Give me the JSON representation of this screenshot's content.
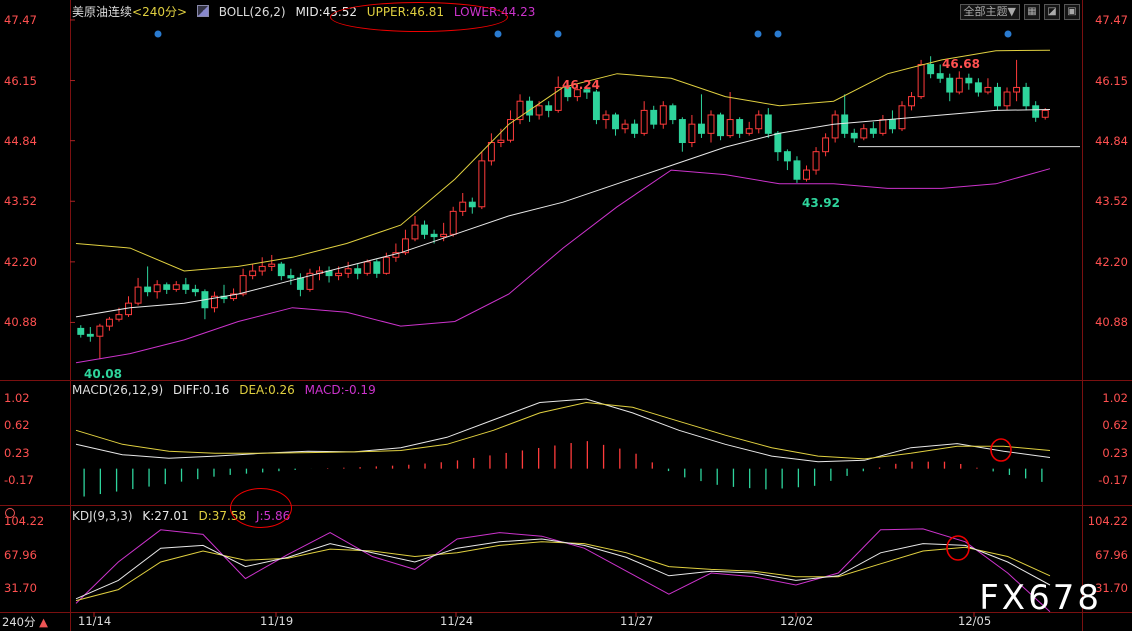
{
  "header": {
    "symbol": "美原油连续",
    "period": "<240分>",
    "boll_label": "BOLL(26,2)",
    "mid": "MID:45.52",
    "upper": "UPPER:46.81",
    "lower": "LOWER:44.23",
    "menu_label": "全部主题▼"
  },
  "macd_legend": {
    "title": "MACD(26,12,9)",
    "diff": "DIFF:0.16",
    "dea": "DEA:0.26",
    "macd": "MACD:-0.19"
  },
  "kdj_legend": {
    "title": "KDJ(9,3,3)",
    "k": "K:27.01",
    "d": "D:37.58",
    "j": "J:5.86"
  },
  "period_tab": "240分",
  "watermark": "FX678",
  "price_axis": [
    "47.47",
    "46.15",
    "44.84",
    "43.52",
    "42.20",
    "40.88"
  ],
  "macd_axis": [
    "1.02",
    "0.62",
    "0.23",
    "-0.17"
  ],
  "kdj_axis": [
    "104.22",
    "67.96",
    "31.70"
  ],
  "dates": [
    "11/14",
    "11/19",
    "11/24",
    "11/27",
    "12/02",
    "12/05"
  ],
  "annotations": {
    "low1": "40.08",
    "high1": "46.24",
    "low2": "43.92",
    "high2": "46.68"
  },
  "colors": {
    "up": "#ff3b3b",
    "down": "#2ed49c",
    "mid": "#e8e8e8",
    "upper": "#e0d040",
    "lower": "#cc33cc",
    "diff": "#e8e8e8",
    "dea": "#e0d040",
    "j": "#cc33cc",
    "axis": "#ff5050",
    "green_text": "#2ed49c"
  },
  "chart_data": {
    "type": "candlestick",
    "ylim": [
      39.8,
      47.6
    ],
    "candles": [
      [
        40.75,
        40.62,
        40.82,
        40.55
      ],
      [
        40.62,
        40.58,
        40.78,
        40.46
      ],
      [
        40.58,
        40.8,
        40.85,
        40.08
      ],
      [
        40.8,
        40.95,
        41.0,
        40.7
      ],
      [
        40.95,
        41.05,
        41.2,
        40.9
      ],
      [
        41.05,
        41.3,
        41.45,
        41.0
      ],
      [
        41.3,
        41.65,
        41.85,
        41.25
      ],
      [
        41.65,
        41.55,
        42.1,
        41.45
      ],
      [
        41.55,
        41.7,
        41.8,
        41.4
      ],
      [
        41.7,
        41.6,
        41.75,
        41.5
      ],
      [
        41.6,
        41.7,
        41.78,
        41.55
      ],
      [
        41.7,
        41.6,
        41.85,
        41.5
      ],
      [
        41.6,
        41.55,
        41.7,
        41.45
      ],
      [
        41.55,
        41.2,
        41.6,
        40.95
      ],
      [
        41.2,
        41.45,
        41.55,
        41.1
      ],
      [
        41.45,
        41.4,
        41.7,
        41.3
      ],
      [
        41.4,
        41.5,
        41.62,
        41.35
      ],
      [
        41.5,
        41.9,
        42.05,
        41.45
      ],
      [
        41.9,
        42.0,
        42.15,
        41.82
      ],
      [
        42.0,
        42.1,
        42.3,
        41.9
      ],
      [
        42.1,
        42.15,
        42.35,
        42.0
      ],
      [
        42.15,
        41.9,
        42.2,
        41.8
      ],
      [
        41.9,
        41.85,
        42.05,
        41.7
      ],
      [
        41.85,
        41.6,
        41.95,
        41.45
      ],
      [
        41.6,
        41.95,
        42.05,
        41.55
      ],
      [
        41.95,
        42.0,
        42.1,
        41.8
      ],
      [
        42.0,
        41.9,
        42.1,
        41.75
      ],
      [
        41.9,
        41.95,
        42.1,
        41.8
      ],
      [
        41.95,
        42.05,
        42.2,
        41.85
      ],
      [
        42.05,
        41.95,
        42.15,
        41.82
      ],
      [
        41.95,
        42.2,
        42.25,
        41.9
      ],
      [
        42.2,
        41.95,
        42.25,
        41.85
      ],
      [
        41.95,
        42.3,
        42.4,
        41.92
      ],
      [
        42.3,
        42.4,
        42.6,
        42.2
      ],
      [
        42.4,
        42.7,
        42.9,
        42.35
      ],
      [
        42.7,
        43.0,
        43.2,
        42.65
      ],
      [
        43.0,
        42.8,
        43.1,
        42.7
      ],
      [
        42.8,
        42.75,
        42.9,
        42.6
      ],
      [
        42.75,
        42.8,
        43.05,
        42.65
      ],
      [
        42.8,
        43.3,
        43.4,
        42.75
      ],
      [
        43.3,
        43.5,
        43.7,
        43.2
      ],
      [
        43.5,
        43.4,
        43.6,
        43.25
      ],
      [
        43.4,
        44.4,
        44.6,
        43.35
      ],
      [
        44.4,
        44.8,
        45.0,
        44.3
      ],
      [
        44.8,
        44.85,
        45.1,
        44.7
      ],
      [
        44.85,
        45.3,
        45.5,
        44.8
      ],
      [
        45.3,
        45.7,
        45.85,
        45.2
      ],
      [
        45.7,
        45.4,
        45.8,
        45.25
      ],
      [
        45.4,
        45.6,
        45.7,
        45.3
      ],
      [
        45.6,
        45.5,
        45.7,
        45.35
      ],
      [
        45.5,
        46.0,
        46.24,
        45.45
      ],
      [
        46.0,
        45.8,
        46.1,
        45.7
      ],
      [
        45.8,
        45.95,
        46.05,
        45.7
      ],
      [
        45.95,
        45.9,
        46.0,
        45.75
      ],
      [
        45.9,
        45.3,
        45.95,
        45.2
      ],
      [
        45.3,
        45.4,
        45.5,
        45.1
      ],
      [
        45.4,
        45.1,
        45.45,
        44.95
      ],
      [
        45.1,
        45.2,
        45.3,
        45.0
      ],
      [
        45.2,
        45.0,
        45.3,
        44.9
      ],
      [
        45.0,
        45.5,
        45.7,
        44.95
      ],
      [
        45.5,
        45.2,
        45.6,
        45.1
      ],
      [
        45.2,
        45.6,
        45.7,
        45.1
      ],
      [
        45.6,
        45.3,
        45.65,
        45.2
      ],
      [
        45.3,
        44.8,
        45.35,
        44.6
      ],
      [
        44.8,
        45.2,
        45.4,
        44.7
      ],
      [
        45.2,
        45.0,
        45.85,
        44.9
      ],
      [
        45.0,
        45.4,
        45.5,
        44.8
      ],
      [
        45.4,
        44.95,
        45.45,
        44.85
      ],
      [
        44.95,
        45.3,
        45.9,
        44.9
      ],
      [
        45.3,
        45.0,
        45.35,
        44.9
      ],
      [
        45.0,
        45.1,
        45.25,
        44.95
      ],
      [
        45.1,
        45.4,
        45.5,
        45.0
      ],
      [
        45.4,
        45.0,
        45.55,
        44.9
      ],
      [
        45.0,
        44.6,
        45.05,
        44.4
      ],
      [
        44.6,
        44.4,
        44.65,
        44.2
      ],
      [
        44.4,
        44.0,
        44.5,
        43.92
      ],
      [
        44.0,
        44.2,
        44.3,
        43.95
      ],
      [
        44.2,
        44.6,
        44.7,
        44.1
      ],
      [
        44.6,
        44.9,
        45.0,
        44.5
      ],
      [
        44.9,
        45.4,
        45.5,
        44.8
      ],
      [
        45.4,
        45.0,
        45.85,
        44.9
      ],
      [
        45.0,
        44.9,
        45.1,
        44.8
      ],
      [
        44.9,
        45.1,
        45.2,
        44.85
      ],
      [
        45.1,
        45.0,
        45.25,
        44.9
      ],
      [
        45.0,
        45.3,
        45.4,
        44.95
      ],
      [
        45.3,
        45.1,
        45.5,
        45.0
      ],
      [
        45.1,
        45.6,
        45.7,
        45.05
      ],
      [
        45.6,
        45.8,
        45.9,
        45.5
      ],
      [
        45.8,
        46.5,
        46.6,
        45.75
      ],
      [
        46.5,
        46.3,
        46.68,
        46.2
      ],
      [
        46.3,
        46.2,
        46.5,
        46.1
      ],
      [
        46.2,
        45.9,
        46.3,
        45.7
      ],
      [
        45.9,
        46.2,
        46.35,
        45.85
      ],
      [
        46.2,
        46.1,
        46.3,
        45.95
      ],
      [
        46.1,
        45.9,
        46.2,
        45.8
      ],
      [
        45.9,
        46.0,
        46.2,
        45.85
      ],
      [
        46.0,
        45.6,
        46.1,
        45.5
      ],
      [
        45.6,
        45.9,
        46.0,
        45.5
      ],
      [
        45.9,
        46.0,
        46.6,
        45.7
      ],
      [
        46.0,
        45.6,
        46.1,
        45.5
      ],
      [
        45.6,
        45.35,
        45.7,
        45.25
      ],
      [
        45.35,
        45.5,
        45.55,
        45.3
      ]
    ],
    "series": [
      {
        "name": "MID",
        "values": [
          41.0,
          41.2,
          41.3,
          41.5,
          41.8,
          42.1,
          42.4,
          42.8,
          43.2,
          43.5,
          43.9,
          44.3,
          44.7,
          45.0,
          45.2,
          45.3,
          45.4,
          45.5,
          45.52
        ]
      },
      {
        "name": "UPPER",
        "values": [
          42.6,
          42.5,
          42.0,
          42.1,
          42.3,
          42.6,
          43.0,
          44.0,
          45.2,
          46.0,
          46.3,
          46.2,
          45.8,
          45.6,
          45.7,
          46.3,
          46.6,
          46.8,
          46.81
        ]
      },
      {
        "name": "LOWER",
        "values": [
          40.0,
          40.2,
          40.5,
          40.9,
          41.2,
          41.1,
          40.8,
          40.9,
          41.5,
          42.5,
          43.4,
          44.2,
          44.1,
          43.9,
          43.9,
          43.8,
          43.8,
          43.9,
          44.23
        ]
      }
    ],
    "macd": {
      "ylim": [
        -0.45,
        1.1
      ],
      "diff": [
        0.35,
        0.2,
        0.15,
        0.18,
        0.22,
        0.25,
        0.24,
        0.3,
        0.45,
        0.7,
        0.95,
        1.0,
        0.8,
        0.55,
        0.35,
        0.18,
        0.1,
        0.12,
        0.3,
        0.36,
        0.25,
        0.16
      ],
      "dea": [
        0.55,
        0.35,
        0.25,
        0.22,
        0.22,
        0.23,
        0.24,
        0.26,
        0.35,
        0.55,
        0.8,
        0.95,
        0.88,
        0.68,
        0.48,
        0.3,
        0.18,
        0.14,
        0.22,
        0.32,
        0.32,
        0.26
      ],
      "hist": [
        -0.4,
        -0.3,
        -0.2,
        -0.1,
        -0.05,
        0.0,
        0.02,
        0.05,
        0.1,
        0.2,
        0.3,
        0.4,
        0.25,
        -0.1,
        -0.25,
        -0.3,
        -0.25,
        -0.05,
        0.1,
        0.1,
        -0.05,
        -0.19
      ]
    },
    "kdj": {
      "ylim": [
        10,
        110
      ],
      "k": [
        20,
        40,
        75,
        78,
        55,
        65,
        80,
        70,
        60,
        75,
        82,
        85,
        78,
        65,
        45,
        50,
        48,
        40,
        45,
        70,
        80,
        78,
        60,
        35
      ],
      "d": [
        18,
        30,
        60,
        72,
        62,
        64,
        74,
        72,
        66,
        70,
        78,
        82,
        80,
        70,
        55,
        52,
        50,
        44,
        44,
        58,
        72,
        76,
        66,
        45
      ],
      "j": [
        15,
        60,
        95,
        90,
        42,
        68,
        92,
        66,
        52,
        85,
        92,
        88,
        75,
        50,
        25,
        48,
        44,
        35,
        48,
        95,
        96,
        82,
        48,
        5.86
      ]
    }
  }
}
